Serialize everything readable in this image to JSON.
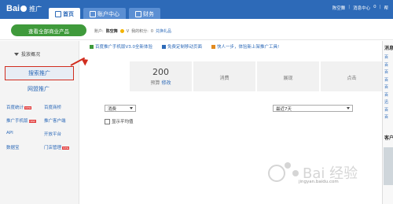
{
  "header": {
    "logo_text": "Bai",
    "logo_sub": "推广",
    "tabs": [
      {
        "label": "首页"
      },
      {
        "label": "账户中心"
      },
      {
        "label": "财务"
      }
    ],
    "top_right": [
      "陈空舞",
      "消息中心",
      "0",
      "帮"
    ]
  },
  "subbar": {
    "green_button": "查看全部商业产品",
    "account_label": "账户:",
    "account_name": "陈空舞",
    "level": "V",
    "points_label": "我的积分:",
    "points_value": "0",
    "points_link": "兑换礼品"
  },
  "leftnav": {
    "heading": "投放概况",
    "selected": "搜索推广",
    "other": "网盟推广",
    "grid": [
      {
        "label": "百度统计",
        "badge": "new"
      },
      {
        "label": "百度商桥",
        "badge": ""
      },
      {
        "label": "推广手机版",
        "badge": "new"
      },
      {
        "label": "推广客户端",
        "badge": ""
      },
      {
        "label": "API",
        "badge": ""
      },
      {
        "label": "开放平台",
        "badge": ""
      },
      {
        "label": "数据宝",
        "badge": ""
      },
      {
        "label": "门店管理",
        "badge": "new"
      }
    ]
  },
  "news": [
    "百度推广手机版V3.0全新体验",
    "免费定制移动页面",
    "快人一步，体验新上架推广工具!"
  ],
  "stats": [
    {
      "num": "200",
      "label": "预算",
      "edit": "修改"
    },
    {
      "num": "",
      "label": "消费",
      "edit": ""
    },
    {
      "num": "",
      "label": "展现",
      "edit": ""
    },
    {
      "num": "",
      "label": "点击",
      "edit": ""
    }
  ],
  "controls": {
    "metric_select": "消费",
    "range_select": "最近7天",
    "avg_checkbox": "显示平均值"
  },
  "rightpanel": {
    "heading": "消息",
    "items": [
      "百",
      "百",
      "百",
      "百",
      "百",
      "百",
      "迅",
      "百",
      "百"
    ],
    "heading2": "客户"
  },
  "watermark": "jingyan.baidu.com"
}
